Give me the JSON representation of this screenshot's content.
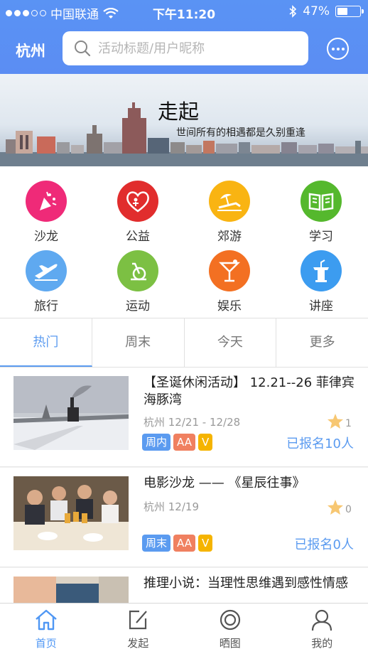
{
  "status_bar": {
    "carrier": "中国联通",
    "time": "下午11:20",
    "battery": "47%",
    "battery_level": 0.47
  },
  "header": {
    "city": "杭州",
    "search_placeholder": "活动标题/用户昵称",
    "more_icon": "more-dots-icon"
  },
  "banner": {
    "title": "走起",
    "subtitle": "世间所有的相遇都是久别重逢"
  },
  "categories": [
    {
      "label": "沙龙",
      "icon": "party-popper-icon",
      "color": "#ef2a78"
    },
    {
      "label": "公益",
      "icon": "heart-charity-icon",
      "color": "#e12d2d"
    },
    {
      "label": "郊游",
      "icon": "beach-umbrella-icon",
      "color": "#f9b412"
    },
    {
      "label": "学习",
      "icon": "open-book-icon",
      "color": "#55b82d"
    },
    {
      "label": "旅行",
      "icon": "airplane-icon",
      "color": "#5fa9f0"
    },
    {
      "label": "运动",
      "icon": "exercise-bike-icon",
      "color": "#7cc043"
    },
    {
      "label": "娱乐",
      "icon": "cocktail-icon",
      "color": "#f37022"
    },
    {
      "label": "讲座",
      "icon": "podium-icon",
      "color": "#3c9cf0"
    }
  ],
  "tabs": [
    "热门",
    "周末",
    "今天",
    "更多"
  ],
  "events": [
    {
      "title": "【圣诞休闲活动】 12.21--26 菲律宾海豚湾",
      "meta": "杭州 12/21 - 12/28",
      "rating": "1",
      "tags": [
        {
          "label": "周内",
          "color": "#5b9bf0"
        },
        {
          "label": "AA",
          "color": "#f08060"
        },
        {
          "label": "V",
          "color": "#f5b400"
        }
      ],
      "signed": "已报名10人"
    },
    {
      "title": "电影沙龙 —— 《星辰往事》",
      "meta": "杭州 12/19",
      "rating": "0",
      "tags": [
        {
          "label": "周末",
          "color": "#5b9bf0"
        },
        {
          "label": "AA",
          "color": "#f08060"
        },
        {
          "label": "V",
          "color": "#f5b400"
        }
      ],
      "signed": "已报名0人"
    },
    {
      "title": "推理小说：当理性思维遇到感性情感",
      "meta": "",
      "rating": "",
      "tags": [],
      "signed": ""
    }
  ],
  "bottom_nav": [
    {
      "label": "首页",
      "icon": "home-icon"
    },
    {
      "label": "发起",
      "icon": "compose-icon"
    },
    {
      "label": "晒图",
      "icon": "camera-lens-icon"
    },
    {
      "label": "我的",
      "icon": "user-icon"
    }
  ]
}
